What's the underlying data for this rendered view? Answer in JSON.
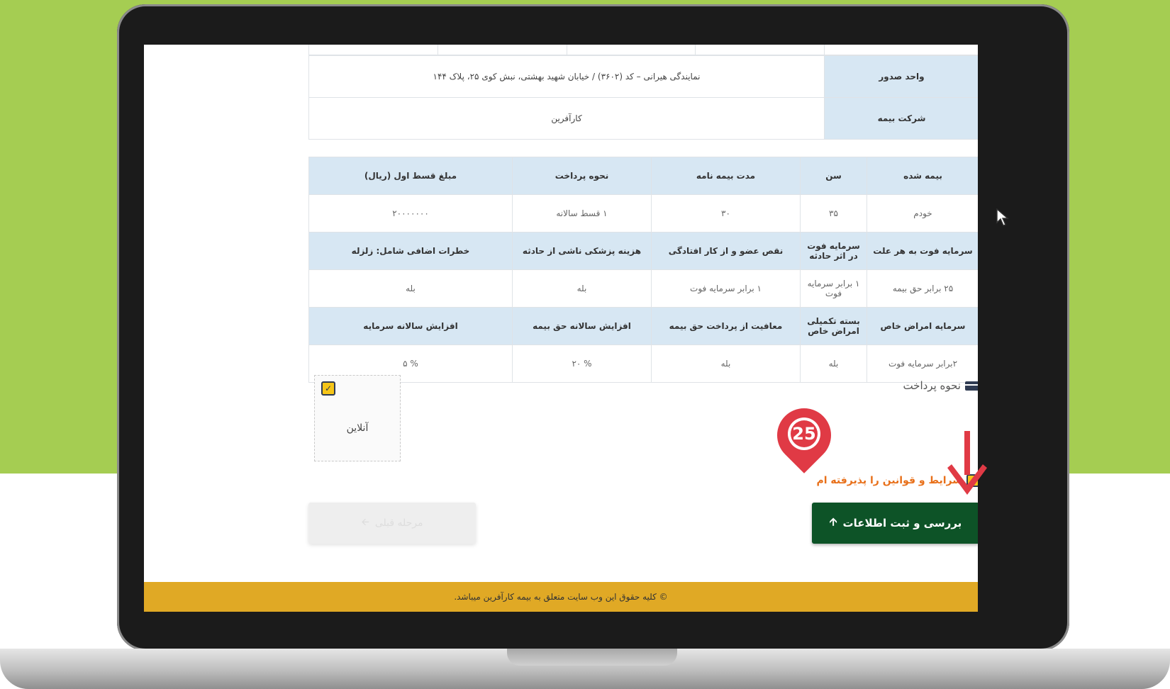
{
  "issuer": {
    "label": "واحد صدور",
    "value": "نمایندگی هیرانی – کد (۳۶۰۲) / خیابان شهید بهشتی، نبش کوی ۲۵، پلاک ۱۴۴"
  },
  "insurer": {
    "label": "شرکت بیمه",
    "value": "کارآفرین"
  },
  "policy_summary": {
    "headers": [
      "بیمه شده",
      "سن",
      "مدت بیمه نامه",
      "نحوه پرداخت",
      "مبلغ قسط اول (ریال)"
    ],
    "row": [
      "خودم",
      "۳۵",
      "۳۰",
      "۱ قسط سالانه",
      "۲۰۰۰۰۰۰۰"
    ]
  },
  "coverage_1": {
    "headers": [
      "سرمایه فوت به هر علت",
      "سرمایه فوت در اثر حادثه",
      "نقص عضو و از کار افتادگی",
      "هزینه پزشکی ناشی از حادثه",
      "خطرات اضافی شامل: زلزله"
    ],
    "row": [
      "۲۵ برابر حق بیمه",
      "۱ برابر سرمایه فوت",
      "۱ برابر سرمایه فوت",
      "بله",
      "بله"
    ]
  },
  "coverage_2": {
    "headers": [
      "سرمایه امراض خاص",
      "بسته تکمیلی امراض خاص",
      "معافیت از پرداخت حق بیمه",
      "افزایش سالانه حق بیمه",
      "افزایش سالانه سرمایه"
    ],
    "row": [
      "۲برابر سرمایه فوت",
      "بله",
      "بله",
      "% ۲۰",
      "% ۵"
    ]
  },
  "payment": {
    "title": "نحوه پرداخت",
    "option_label": "آنلاین",
    "option_checked_glyph": "✓"
  },
  "terms": {
    "label": "شرایط و قوانین را پذیرفته ام",
    "checked_glyph": "✓"
  },
  "buttons": {
    "submit_label": "بررسی و ثبت اطلاعات",
    "submit_icon": "🡩",
    "prev_label": "مرحله قبلی",
    "prev_icon": "🡨"
  },
  "footer": {
    "text": "© کلیه حقوق این وب سایت متعلق به بیمه کارآفرین میباشد."
  },
  "annotation": {
    "step_number": "25"
  },
  "colors": {
    "background_green": "#a5cd52",
    "header_blue": "#d7e7f3",
    "submit_green": "#0d5327",
    "footer_gold": "#e0a925",
    "terms_orange": "#e8701a",
    "marker_red": "#e03a45"
  }
}
